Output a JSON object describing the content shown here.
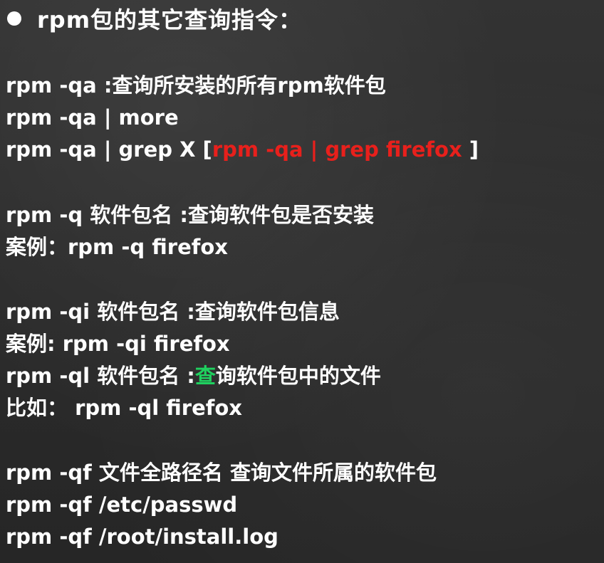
{
  "title": "rpm包的其它查询指令：",
  "lines": {
    "l1": "rpm -qa :查询所安装的所有rpm软件包",
    "l2": "rpm -qa | more",
    "l3_pre": "rpm -qa | grep X [",
    "l3_red": "rpm -qa | grep firefox",
    "l3_post": " ]",
    "l4": "rpm -q 软件包名 :查询软件包是否安装",
    "l5": "案例：rpm -q firefox",
    "l6": "rpm -qi 软件包名  :查询软件包信息",
    "l7": "案例: rpm -qi firefox",
    "l8_pre": "rpm -ql 软件包名 :",
    "l8_green": "查",
    "l8_post": "询软件包中的文件",
    "l9": "比如：  rpm -ql firefox",
    "l10": "rpm -qf 文件全路径名 查询文件所属的软件包",
    "l11": "rpm -qf /etc/passwd",
    "l12": "rpm -qf /root/install.log"
  },
  "colors": {
    "text": "#ffffff",
    "highlight_red": "#e8201c",
    "highlight_green": "#1fd15f",
    "background": "#2c2c2c"
  }
}
